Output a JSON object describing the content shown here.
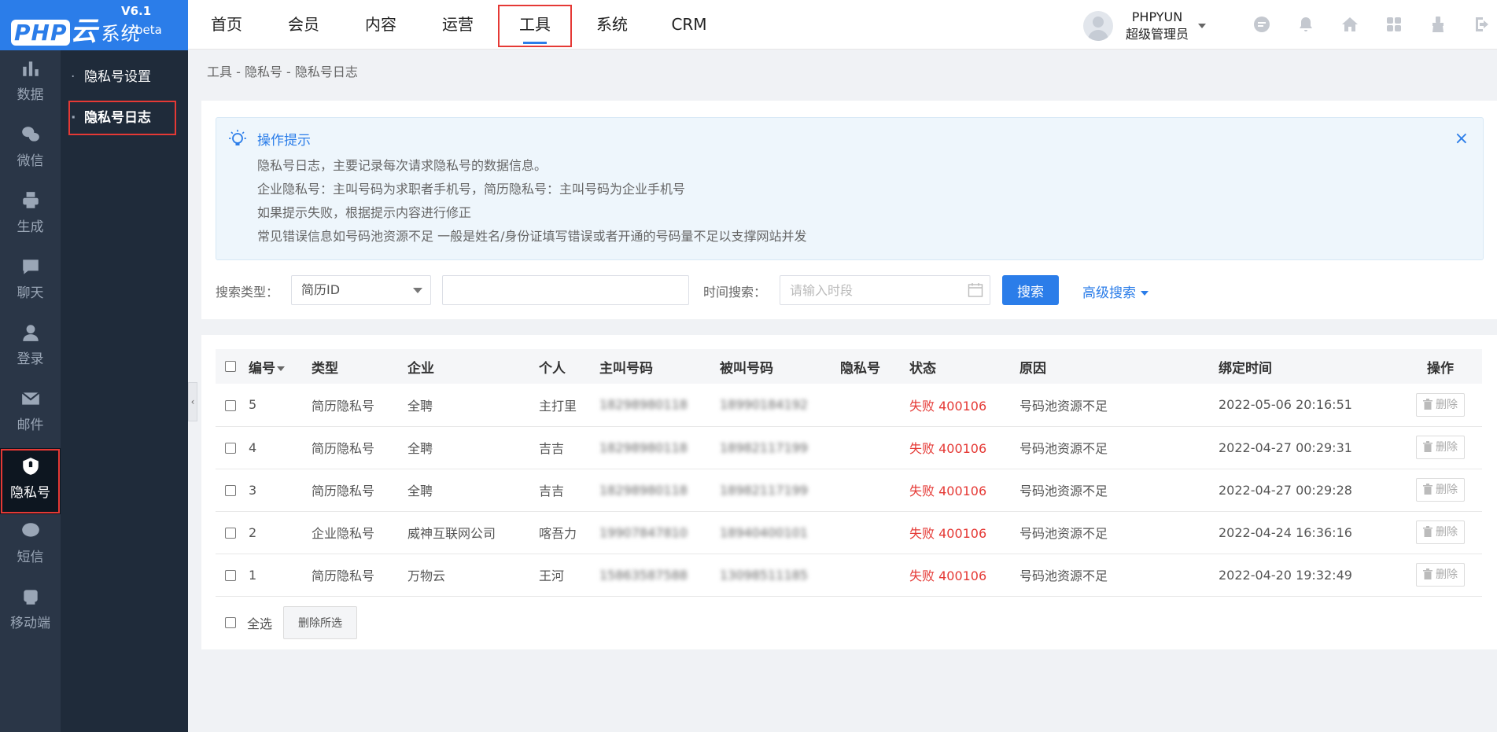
{
  "logo": {
    "brand_php": "PHP",
    "brand_yun": "云",
    "brand_sys": "系统",
    "version": "V6.1",
    "beta": "beta"
  },
  "topnav": [
    {
      "label": "首页"
    },
    {
      "label": "会员"
    },
    {
      "label": "内容"
    },
    {
      "label": "运营"
    },
    {
      "label": "工具",
      "active": true
    },
    {
      "label": "系统"
    },
    {
      "label": "CRM"
    }
  ],
  "user": {
    "name": "PHPYUN",
    "role": "超级管理员"
  },
  "tool_icons": [
    "chat-icon",
    "bell-icon",
    "home-icon",
    "apps-icon",
    "brush-icon",
    "logout-icon"
  ],
  "iconbar": [
    {
      "label": "数据",
      "icon": "bar-chart-icon"
    },
    {
      "label": "微信",
      "icon": "wechat-icon"
    },
    {
      "label": "生成",
      "icon": "printer-icon"
    },
    {
      "label": "聊天",
      "icon": "chat-bubble-icon"
    },
    {
      "label": "登录",
      "icon": "user-icon"
    },
    {
      "label": "邮件",
      "icon": "mail-icon"
    },
    {
      "label": "隐私号",
      "icon": "shield-icon",
      "active": true
    },
    {
      "label": "短信",
      "icon": "message-icon"
    },
    {
      "label": "移动端",
      "icon": "mobile-icon"
    }
  ],
  "subbar": [
    {
      "label": "隐私号设置"
    },
    {
      "label": "隐私号日志",
      "active": true
    }
  ],
  "breadcrumb": "工具 - 隐私号 - 隐私号日志",
  "tip": {
    "title": "操作提示",
    "lines": [
      "隐私号日志，主要记录每次请求隐私号的数据信息。",
      "企业隐私号：主叫号码为求职者手机号，简历隐私号：主叫号码为企业手机号",
      "如果提示失败，根据提示内容进行修正",
      "常见错误信息如号码池资源不足 一般是姓名/身份证填写错误或者开通的号码量不足以支撑网站并发"
    ],
    "close": "×"
  },
  "search": {
    "type_label": "搜索类型：",
    "type_value": "简历ID",
    "keyword_value": "",
    "time_label": "时间搜索：",
    "time_placeholder": "请输入时段",
    "button": "搜索",
    "advanced": "高级搜索"
  },
  "table": {
    "headers": [
      "编号",
      "类型",
      "企业",
      "个人",
      "主叫号码",
      "被叫号码",
      "隐私号",
      "状态",
      "原因",
      "绑定时间",
      "操作"
    ],
    "rows": [
      {
        "id": "5",
        "type": "简历隐私号",
        "company": "全聘",
        "person": "主打里",
        "caller": "18298980118",
        "callee": "18990184192",
        "privacy": "",
        "status": "失败 400106",
        "reason": "号码池资源不足",
        "time": "2022-05-06 20:16:51",
        "action": "删除"
      },
      {
        "id": "4",
        "type": "简历隐私号",
        "company": "全聘",
        "person": "吉吉",
        "caller": "18298980118",
        "callee": "18982117199",
        "privacy": "",
        "status": "失败 400106",
        "reason": "号码池资源不足",
        "time": "2022-04-27 00:29:31",
        "action": "删除"
      },
      {
        "id": "3",
        "type": "简历隐私号",
        "company": "全聘",
        "person": "吉吉",
        "caller": "18298980118",
        "callee": "18982117199",
        "privacy": "",
        "status": "失败 400106",
        "reason": "号码池资源不足",
        "time": "2022-04-27 00:29:28",
        "action": "删除"
      },
      {
        "id": "2",
        "type": "企业隐私号",
        "company": "威神互联网公司",
        "person": "喀吾力",
        "caller": "19907847810",
        "callee": "18940400101",
        "privacy": "",
        "status": "失败 400106",
        "reason": "号码池资源不足",
        "time": "2022-04-24 16:36:16",
        "action": "删除"
      },
      {
        "id": "1",
        "type": "简历隐私号",
        "company": "万物云",
        "person": "王河",
        "caller": "15863587588",
        "callee": "13098511185",
        "privacy": "",
        "status": "失败 400106",
        "reason": "号码池资源不足",
        "time": "2022-04-20 19:32:49",
        "action": "删除"
      }
    ]
  },
  "footer": {
    "select_all": "全选",
    "batch_delete": "删除所选"
  },
  "colors": {
    "brand": "#2b7de9",
    "sidebar": "#2a3647",
    "fail": "#e53935",
    "highlight": "#e53935"
  }
}
